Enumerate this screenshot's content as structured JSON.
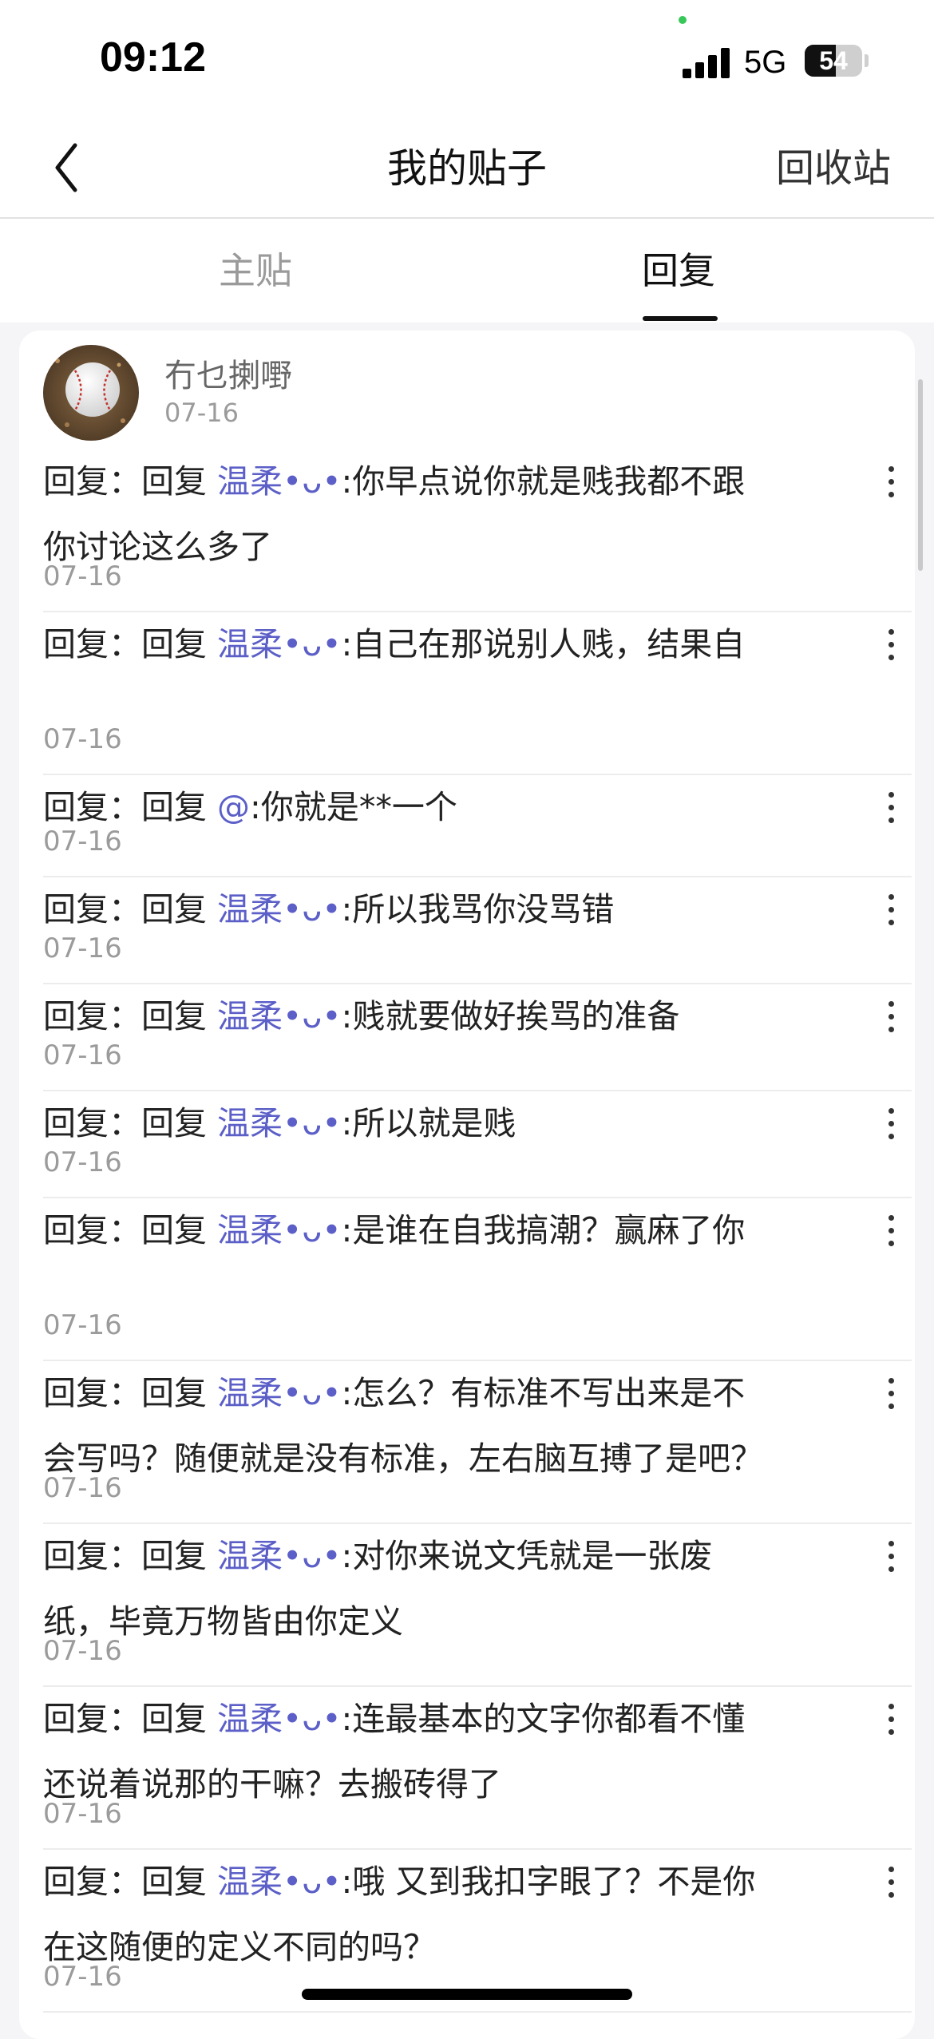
{
  "status_bar": {
    "time": "09:12",
    "network": "5G",
    "battery": "54",
    "battery_level": 0.54
  },
  "nav": {
    "back_icon": "chevron-left-icon",
    "title": "我的贴子",
    "recycle": "回收站"
  },
  "tabs": [
    {
      "label": "主贴",
      "active": false
    },
    {
      "label": "回复",
      "active": true
    }
  ],
  "author": {
    "name": "冇乜揦嘢",
    "date": "07-16",
    "avatar": "baseball-avatar"
  },
  "replies": [
    {
      "prefix": "回复：回复",
      "mention": "温柔•ᴗ•",
      "text": ":你早点说你就是贱我都不跟你讨论这么多了",
      "date": "07-16"
    },
    {
      "prefix": "回复：回复",
      "mention": "温柔•ᴗ•",
      "text": ":自己在那说别人贱，结果自",
      "date": "07-16"
    },
    {
      "prefix": "回复：回复",
      "mention": "@",
      "text": ":你就是**一个",
      "date": "07-16"
    },
    {
      "prefix": "回复：回复",
      "mention": "温柔•ᴗ•",
      "text": ":所以我骂你没骂错",
      "date": "07-16"
    },
    {
      "prefix": "回复：回复",
      "mention": "温柔•ᴗ•",
      "text": ":贱就要做好挨骂的准备",
      "date": "07-16"
    },
    {
      "prefix": "回复：回复",
      "mention": "温柔•ᴗ•",
      "text": ":所以就是贱",
      "date": "07-16"
    },
    {
      "prefix": "回复：回复",
      "mention": "温柔•ᴗ•",
      "text": ":是谁在自我搞潮？赢麻了你",
      "date": "07-16"
    },
    {
      "prefix": "回复：回复",
      "mention": "温柔•ᴗ•",
      "text": ":怎么？有标准不写出来是不会写吗？随便就是没有标准，左右脑互搏了是吧？",
      "date": "07-16"
    },
    {
      "prefix": "回复：回复",
      "mention": "温柔•ᴗ•",
      "text": ":对你来说文凭就是一张废纸，毕竟万物皆由你定义",
      "date": "07-16"
    },
    {
      "prefix": "回复：回复",
      "mention": "温柔•ᴗ•",
      "text": ":连最基本的文字你都看不懂还说着说那的干嘛？去搬砖得了",
      "date": "07-16"
    },
    {
      "prefix": "回复：回复",
      "mention": "温柔•ᴗ•",
      "text": ":哦 又到我扣字眼了？不是你在这随便的定义不同的吗？",
      "date": "07-16"
    }
  ],
  "more_icon": "more-vertical-icon",
  "colors": {
    "mention": "#5b5fc7",
    "date": "#9b9b9b",
    "background": "#f5f5f7"
  }
}
